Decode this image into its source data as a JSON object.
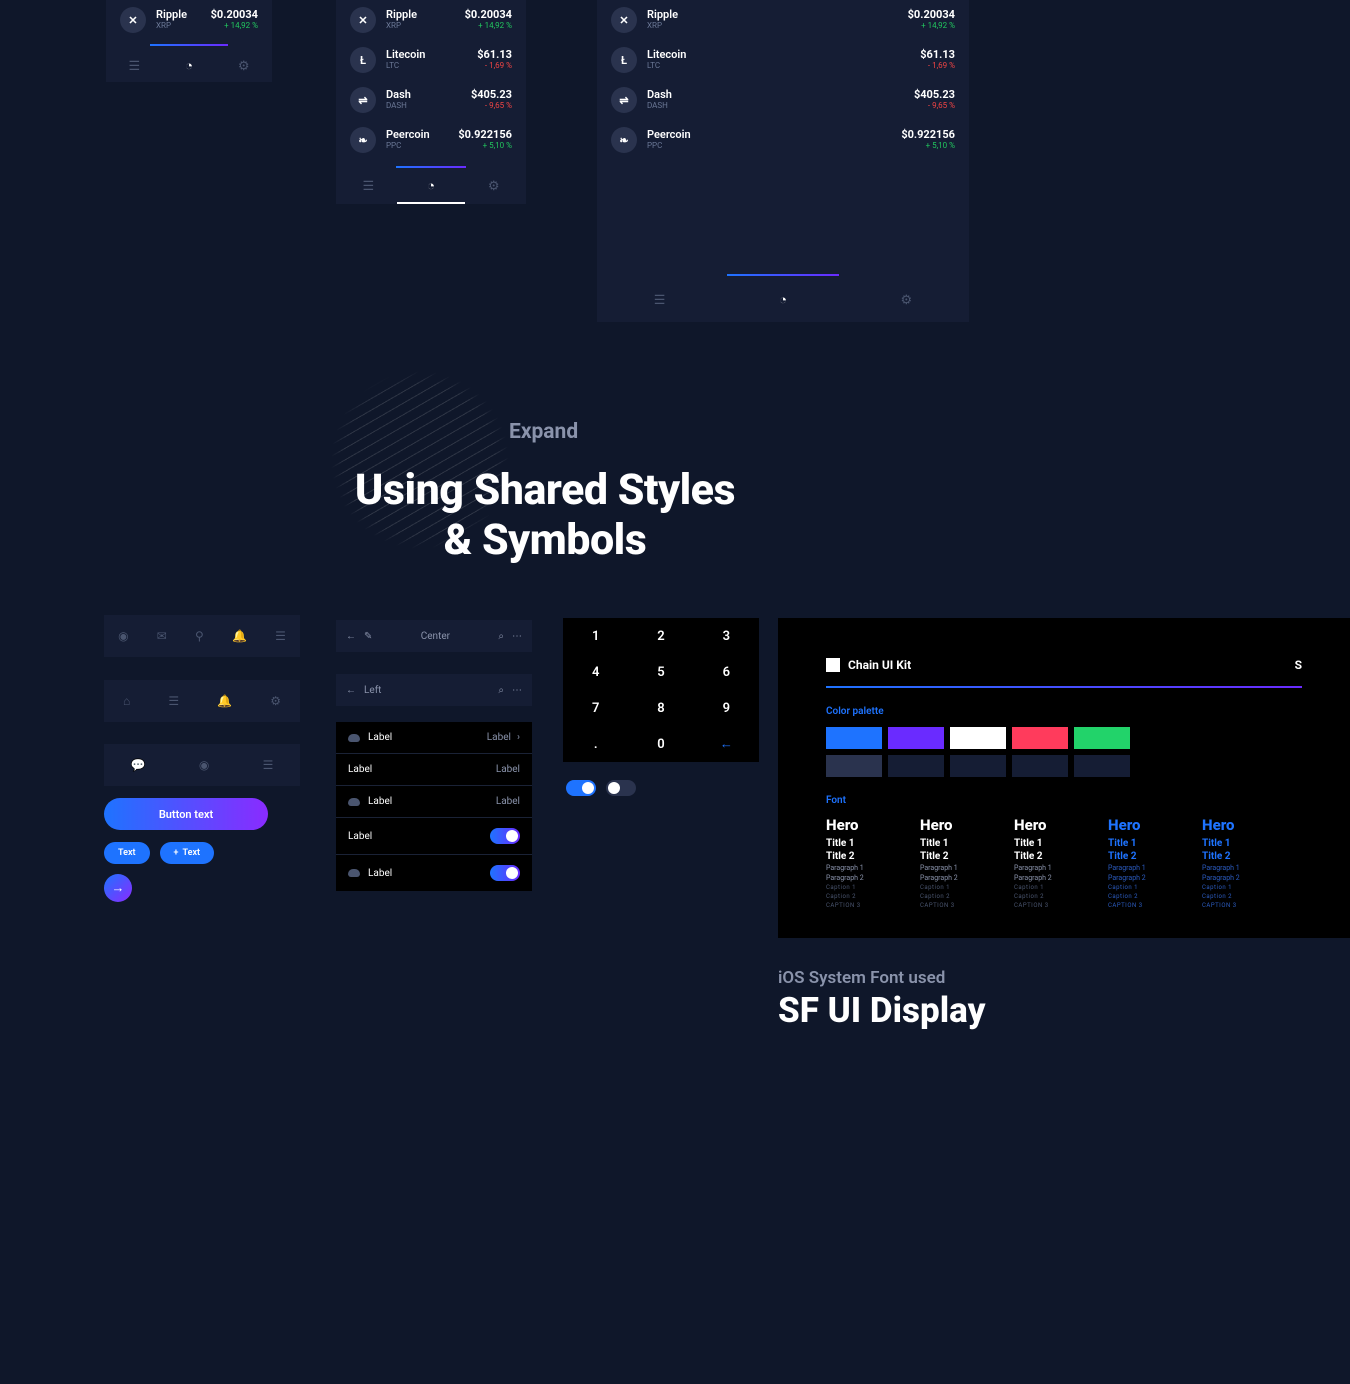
{
  "coins": {
    "ripple": {
      "name": "Ripple",
      "sym": "XRP",
      "price": "$0.20034",
      "chg": "+ 14,92 %",
      "dir": "pos",
      "glyph": "✕"
    },
    "litecoin": {
      "name": "Litecoin",
      "sym": "LTC",
      "price": "$61.13",
      "chg": "- 1,69 %",
      "dir": "neg",
      "glyph": "Ł"
    },
    "dash": {
      "name": "Dash",
      "sym": "DASH",
      "price": "$405.23",
      "chg": "- 9,65 %",
      "dir": "neg",
      "glyph": "⇌"
    },
    "peercoin": {
      "name": "Peercoin",
      "sym": "PPC",
      "price": "$0.922156",
      "chg": "+ 5,10 %",
      "dir": "pos",
      "glyph": "❧"
    }
  },
  "hero": {
    "eyebrow": "Expand",
    "line1": "Using Shared Styles",
    "line2": "& Symbols"
  },
  "toolbar": {
    "center": "Center",
    "left": "Left"
  },
  "list": {
    "label": "Label"
  },
  "buttons": {
    "main": "Button text",
    "pill": "Text",
    "pill_plus": "Text"
  },
  "keypad": {
    "keys": [
      [
        "1",
        "2",
        "3"
      ],
      [
        "4",
        "5",
        "6"
      ],
      [
        "7",
        "8",
        "9"
      ],
      [
        ".",
        "0",
        "←"
      ]
    ]
  },
  "guide": {
    "title": "Chain UI Kit",
    "corner": "S",
    "palette_label": "Color palette",
    "font_label": "Font",
    "hero": "Hero",
    "title1": "Title 1",
    "title2": "Title 2",
    "p1": "Paragraph 1",
    "p2": "Paragraph 2",
    "c1": "Caption 1",
    "c2": "Caption 2",
    "c3": "CAPTION 3"
  },
  "footer": {
    "note": "iOS System Font used",
    "font": "SF UI Display"
  },
  "colors": {
    "blue": "#1e73ff",
    "purple": "#6a2bff",
    "white": "#ffffff",
    "red": "#ff3b5c",
    "green": "#22d36a",
    "slate": "#2a334e",
    "dark": "#151d34"
  }
}
